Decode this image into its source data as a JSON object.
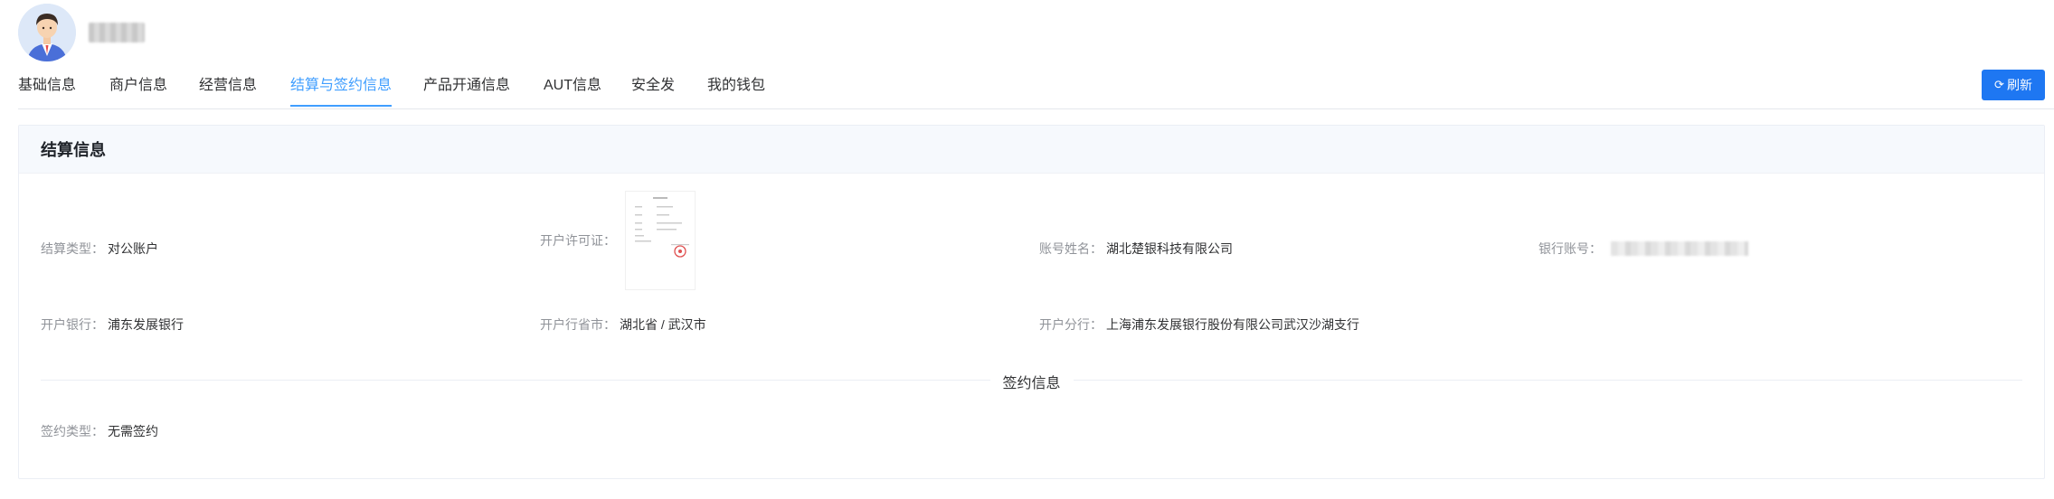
{
  "tabs": [
    {
      "label": "基础信息"
    },
    {
      "label": "商户信息"
    },
    {
      "label": "经营信息"
    },
    {
      "label": "结算与签约信息",
      "active": true
    },
    {
      "label": "产品开通信息"
    },
    {
      "label": "AUT信息"
    },
    {
      "label": "安全发"
    },
    {
      "label": "我的钱包"
    }
  ],
  "refresh_button": {
    "icon": "refresh-icon",
    "label": "刷新"
  },
  "settlement": {
    "title": "结算信息",
    "type_label": "结算类型：",
    "type_value": "对公账户",
    "license_label": "开户许可证：",
    "account_name_label": "账号姓名：",
    "account_name_value": "湖北楚银科技有限公司",
    "bank_account_label": "银行账号：",
    "bank_label": "开户银行：",
    "bank_value": "浦东发展银行",
    "region_label": "开户行省市：",
    "region_value": "湖北省 / 武汉市",
    "branch_label": "开户分行：",
    "branch_value": "上海浦东发展银行股份有限公司武汉沙湖支行"
  },
  "signing": {
    "title": "签约信息",
    "type_label": "签约类型：",
    "type_value": "无需签约"
  },
  "colors": {
    "accent": "#409eff",
    "button": "#1e77f2"
  }
}
